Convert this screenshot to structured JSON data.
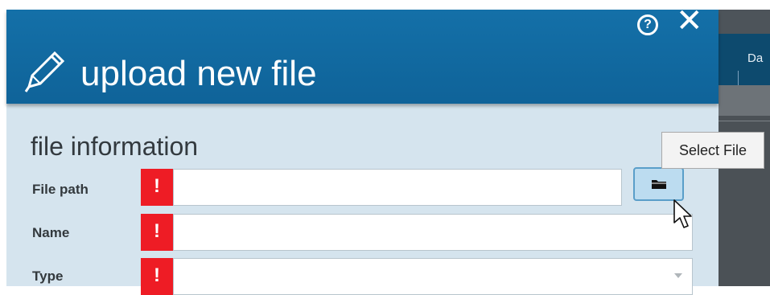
{
  "modal": {
    "title": "upload new file",
    "help_icon": "question-circle-icon",
    "help_glyph": "?",
    "close_icon": "close-icon",
    "close_glyph": "✕",
    "section_title": "file information"
  },
  "form": {
    "fields": [
      {
        "label": "File path",
        "required_mark": "!",
        "value": ""
      },
      {
        "label": "Name",
        "required_mark": "!",
        "value": ""
      },
      {
        "label": "Type",
        "required_mark": "!",
        "value": ""
      }
    ],
    "browse_icon": "folder-icon"
  },
  "tooltip": {
    "text": "Select File"
  },
  "background_app": {
    "header_text": "Da"
  },
  "colors": {
    "header_blue": "#1470a8",
    "required_red": "#ee1c25",
    "modal_body": "#d5e4ee"
  }
}
